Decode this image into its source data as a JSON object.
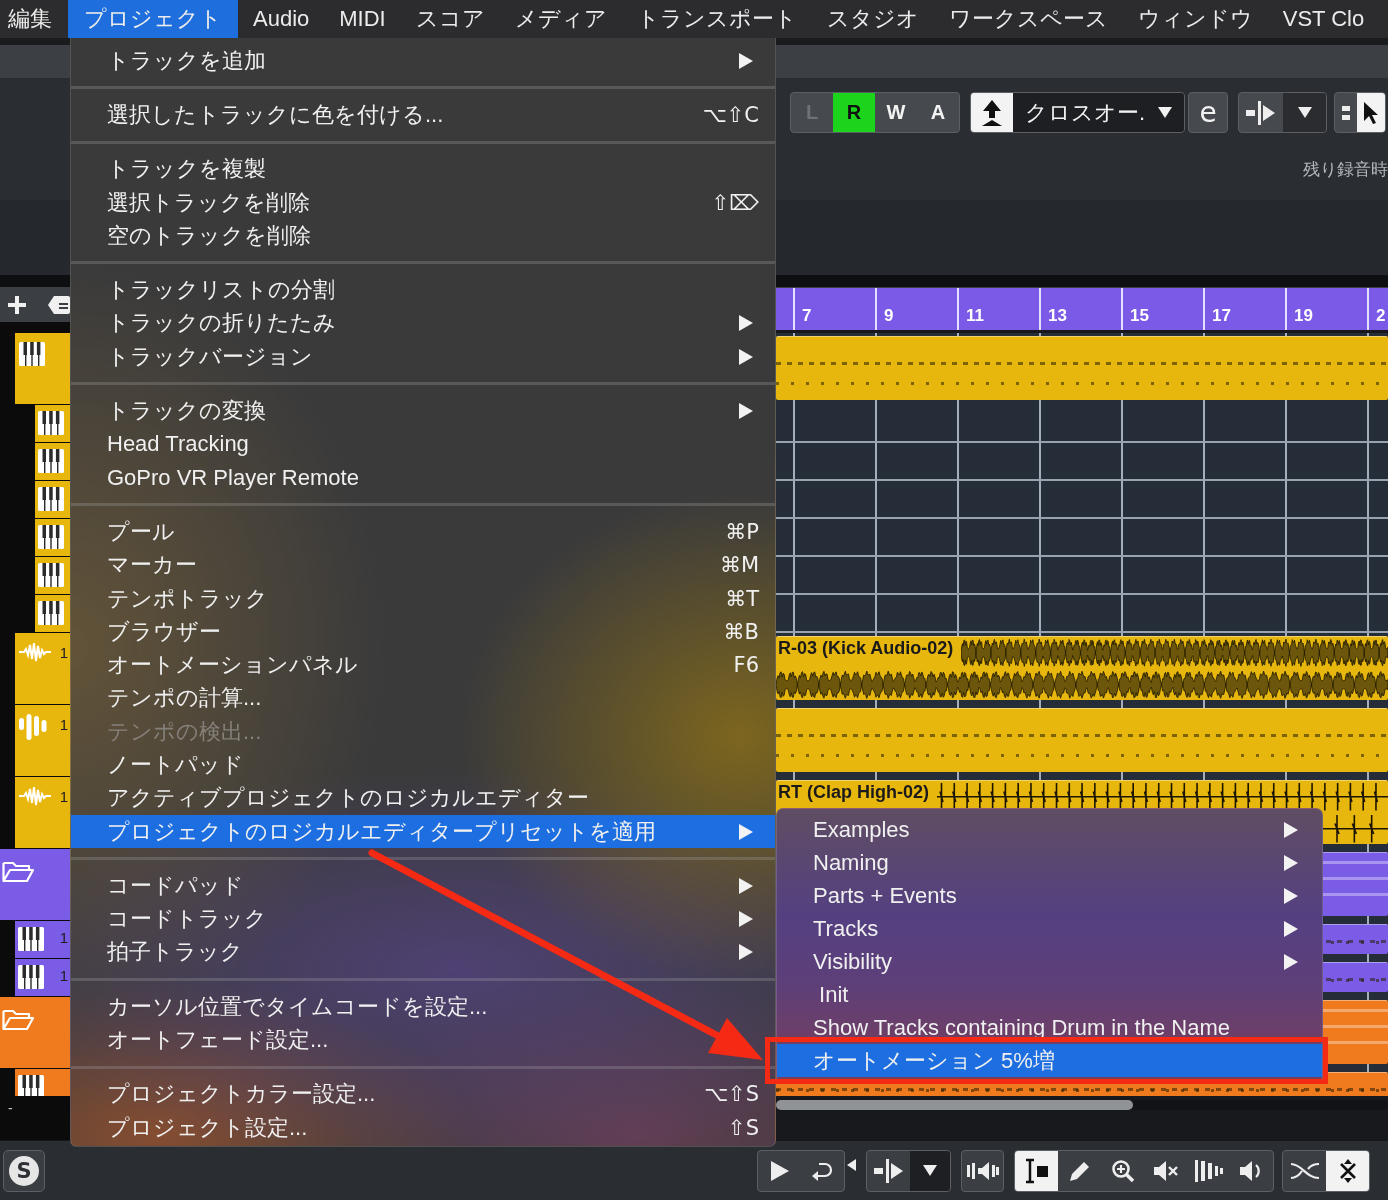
{
  "menubar": [
    {
      "label": "編集",
      "selected": false
    },
    {
      "label": "プロジェクト",
      "selected": true
    },
    {
      "label": "Audio",
      "selected": false
    },
    {
      "label": "MIDI",
      "selected": false
    },
    {
      "label": "スコア",
      "selected": false
    },
    {
      "label": "メディア",
      "selected": false
    },
    {
      "label": "トランスポート",
      "selected": false
    },
    {
      "label": "スタジオ",
      "selected": false
    },
    {
      "label": "ワークスペース",
      "selected": false
    },
    {
      "label": "ウィンドウ",
      "selected": false
    },
    {
      "label": "VST Clo",
      "selected": false
    }
  ],
  "toolbar": {
    "automation_buttons": [
      {
        "label": "L",
        "on": false,
        "disabled": true
      },
      {
        "label": "R",
        "on": true,
        "disabled": false
      },
      {
        "label": "W",
        "on": false,
        "disabled": false
      },
      {
        "label": "A",
        "on": false,
        "disabled": false
      }
    ],
    "mode_toggle": {
      "on": true
    },
    "crossfade_dropdown": {
      "value": "クロスオー."
    },
    "edit_button": {
      "label": "e"
    },
    "pointer_tool": {
      "selected": true
    },
    "status_text": "残り録音時"
  },
  "track_list": {
    "tracks": [
      {
        "kind": "instrument",
        "color": "#e8b70d",
        "part": {
          "kind": "midi"
        },
        "children": [
          {
            "kind": "instrument",
            "color": "#e8b70d"
          },
          {
            "kind": "instrument",
            "color": "#e8b70d"
          },
          {
            "kind": "instrument",
            "color": "#e8b70d"
          },
          {
            "kind": "instrument",
            "color": "#e8b70d"
          },
          {
            "kind": "instrument",
            "color": "#e8b70d"
          },
          {
            "kind": "instrument",
            "color": "#e8b70d"
          }
        ]
      },
      {
        "kind": "audio",
        "color": "#e8b70d",
        "number": "1",
        "part": {
          "kind": "audio",
          "name": "R-03 (Kick Audio-02)"
        }
      },
      {
        "kind": "sampler",
        "color": "#e8b70d",
        "number": "1",
        "part": {
          "kind": "midi"
        }
      },
      {
        "kind": "audio",
        "color": "#e8b70d",
        "number": "1",
        "part": {
          "kind": "hits",
          "name": "RT (Clap High-02)"
        }
      },
      {
        "kind": "folder",
        "color": "#7b5ce6",
        "part": {
          "kind": "folder"
        },
        "children": [
          {
            "kind": "instrument",
            "color": "#7b5ce6",
            "number": "1",
            "part": {
              "kind": "midi"
            }
          },
          {
            "kind": "instrument",
            "color": "#7b5ce6",
            "number": "1",
            "part": {
              "kind": "midi"
            }
          }
        ]
      },
      {
        "kind": "folder",
        "color": "#f07a1e",
        "part": {
          "kind": "folder"
        },
        "children": [
          {
            "kind": "instrument",
            "color": "#f07a1e",
            "part": {
              "kind": "midi"
            }
          }
        ]
      }
    ],
    "footer": "-"
  },
  "ruler": {
    "bars": [
      "7",
      "9",
      "11",
      "13",
      "15",
      "17",
      "19",
      "2"
    ]
  },
  "project_menu": {
    "sections": [
      {
        "items": [
          {
            "label": "トラックを追加",
            "has_submenu": true,
            "disabled": false,
            "selected": false
          }
        ]
      },
      {
        "items": [
          {
            "label": "選択したトラックに色を付ける...",
            "shortcut": "⌥⇧C",
            "has_submenu": false,
            "disabled": false,
            "selected": false
          }
        ]
      },
      {
        "items": [
          {
            "label": "トラックを複製",
            "has_submenu": false,
            "disabled": false,
            "selected": false
          },
          {
            "label": "選択トラックを削除",
            "shortcut": "⇧⌦",
            "has_submenu": false,
            "disabled": false,
            "selected": false
          },
          {
            "label": "空のトラックを削除",
            "has_submenu": false,
            "disabled": false,
            "selected": false
          }
        ]
      },
      {
        "items": [
          {
            "label": "トラックリストの分割",
            "has_submenu": false,
            "disabled": false,
            "selected": false
          },
          {
            "label": "トラックの折りたたみ",
            "has_submenu": true,
            "disabled": false,
            "selected": false
          },
          {
            "label": "トラックバージョン",
            "has_submenu": true,
            "disabled": false,
            "selected": false
          }
        ]
      },
      {
        "items": [
          {
            "label": "トラックの変換",
            "has_submenu": true,
            "disabled": false,
            "selected": false
          },
          {
            "label": "Head Tracking",
            "has_submenu": false,
            "disabled": false,
            "selected": false
          },
          {
            "label": "GoPro VR Player Remote",
            "has_submenu": false,
            "disabled": false,
            "selected": false
          }
        ]
      },
      {
        "items": [
          {
            "label": "プール",
            "shortcut": "⌘P",
            "has_submenu": false,
            "disabled": false,
            "selected": false
          },
          {
            "label": "マーカー",
            "shortcut": "⌘M",
            "has_submenu": false,
            "disabled": false,
            "selected": false
          },
          {
            "label": "テンポトラック",
            "shortcut": "⌘T",
            "has_submenu": false,
            "disabled": false,
            "selected": false
          },
          {
            "label": "ブラウザー",
            "shortcut": "⌘B",
            "has_submenu": false,
            "disabled": false,
            "selected": false
          },
          {
            "label": "オートメーションパネル",
            "shortcut": "F6",
            "has_submenu": false,
            "disabled": false,
            "selected": false
          },
          {
            "label": "テンポの計算...",
            "has_submenu": false,
            "disabled": false,
            "selected": false
          },
          {
            "label": "テンポの検出...",
            "has_submenu": false,
            "disabled": true,
            "selected": false
          },
          {
            "label": "ノートパッド",
            "has_submenu": false,
            "disabled": false,
            "selected": false
          },
          {
            "label": "アクティブプロジェクトのロジカルエディター",
            "has_submenu": false,
            "disabled": false,
            "selected": false
          },
          {
            "label": "プロジェクトのロジカルエディタープリセットを適用",
            "has_submenu": true,
            "disabled": false,
            "selected": true
          }
        ]
      },
      {
        "items": [
          {
            "label": "コードパッド",
            "has_submenu": true,
            "disabled": false,
            "selected": false
          },
          {
            "label": "コードトラック",
            "has_submenu": true,
            "disabled": false,
            "selected": false
          },
          {
            "label": "拍子トラック",
            "has_submenu": true,
            "disabled": false,
            "selected": false
          }
        ]
      },
      {
        "items": [
          {
            "label": "カーソル位置でタイムコードを設定...",
            "has_submenu": false,
            "disabled": false,
            "selected": false
          },
          {
            "label": "オートフェード設定...",
            "has_submenu": false,
            "disabled": false,
            "selected": false
          }
        ]
      },
      {
        "items": [
          {
            "label": "プロジェクトカラー設定...",
            "shortcut": "⌥⇧S",
            "has_submenu": false,
            "disabled": false,
            "selected": false
          },
          {
            "label": "プロジェクト設定...",
            "shortcut": "⇧S",
            "has_submenu": false,
            "disabled": false,
            "selected": false
          }
        ]
      }
    ]
  },
  "preset_submenu": {
    "items": [
      {
        "label": "Examples",
        "has_submenu": true,
        "disabled": false,
        "selected": false
      },
      {
        "label": "Naming",
        "has_submenu": true,
        "disabled": false,
        "selected": false
      },
      {
        "label": "Parts + Events",
        "has_submenu": true,
        "disabled": false,
        "selected": false
      },
      {
        "label": "Tracks",
        "has_submenu": true,
        "disabled": false,
        "selected": false
      },
      {
        "label": "Visibility",
        "has_submenu": true,
        "disabled": false,
        "selected": false
      },
      {
        "label": " Init",
        "has_submenu": false,
        "disabled": false,
        "selected": false
      },
      {
        "label": "Show Tracks containing Drum in the Name",
        "has_submenu": false,
        "disabled": false,
        "selected": false
      },
      {
        "label": "オートメーション 5%増",
        "has_submenu": false,
        "disabled": false,
        "selected": true
      }
    ]
  },
  "bottom_toolbar": {
    "logo": "S",
    "tools": [
      {
        "kind": "range",
        "selected": true
      },
      {
        "kind": "draw",
        "selected": false
      },
      {
        "kind": "zoom",
        "selected": false
      },
      {
        "kind": "mute",
        "selected": false
      },
      {
        "kind": "warp",
        "selected": false
      },
      {
        "kind": "play",
        "selected": false
      }
    ],
    "snap_tools": [
      {
        "kind": "curve",
        "selected": false
      },
      {
        "kind": "cross",
        "selected": true
      }
    ]
  }
}
